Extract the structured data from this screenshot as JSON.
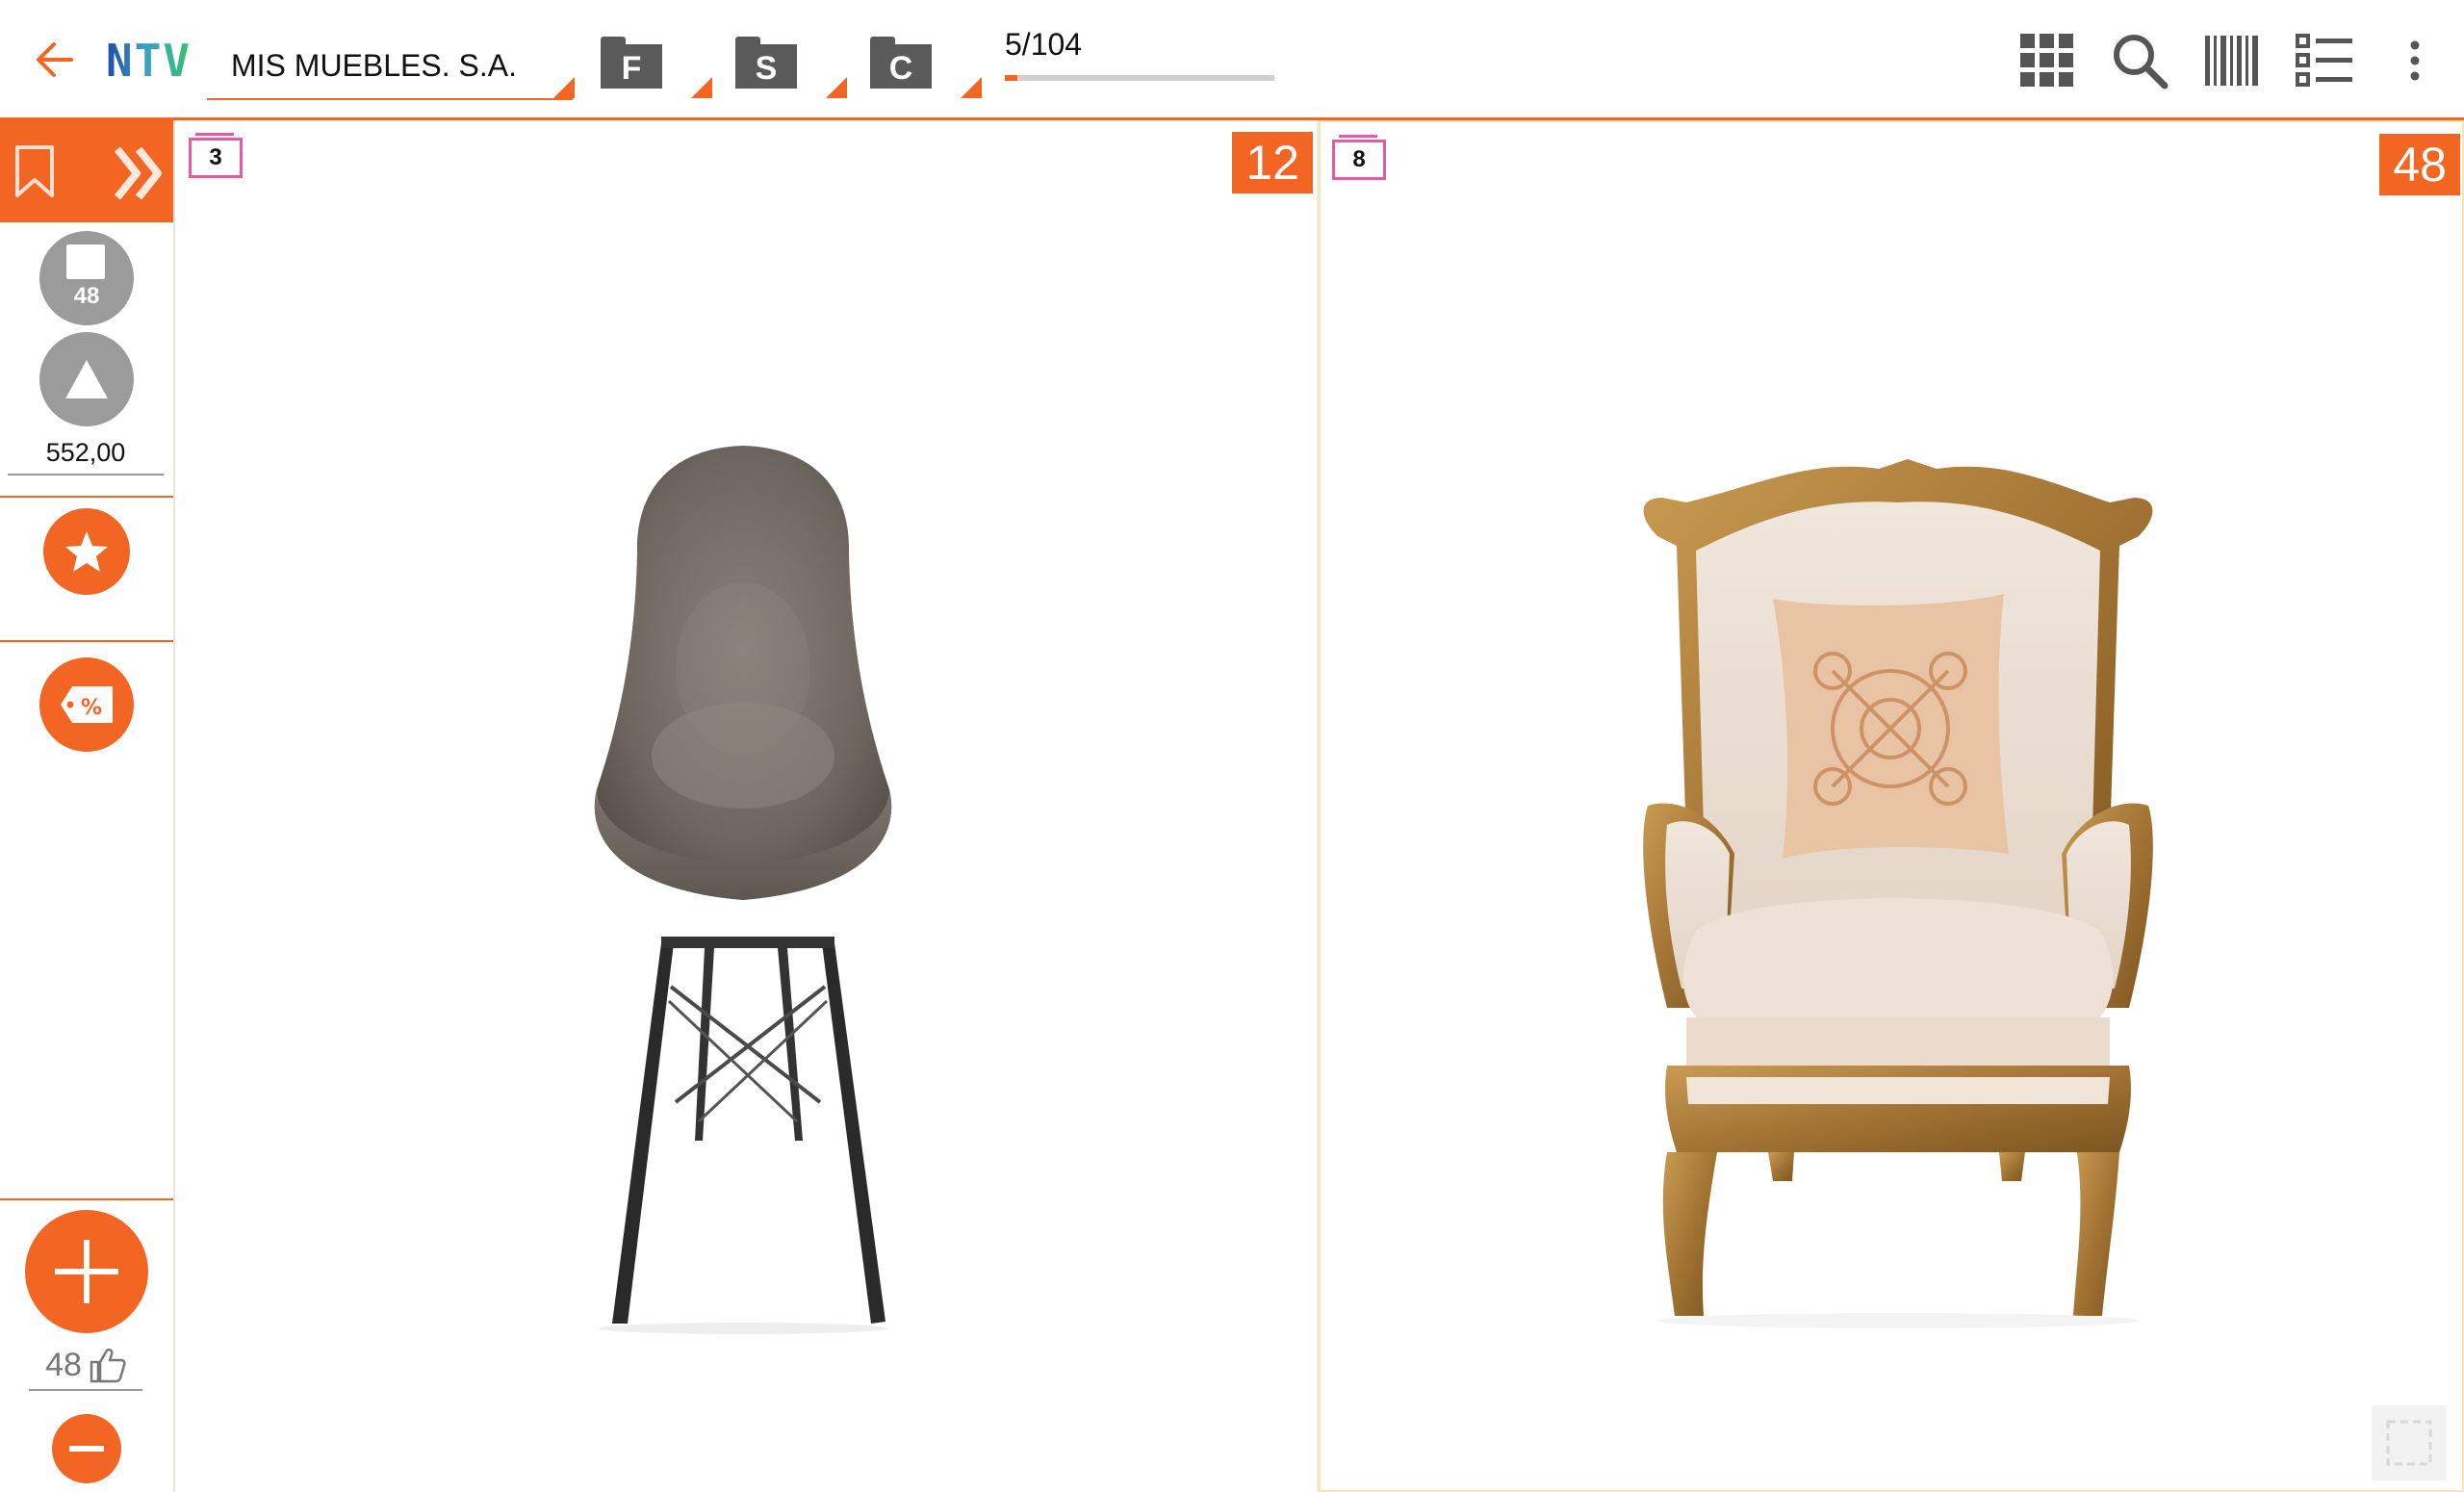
{
  "header": {
    "logo_text": "NTV",
    "company": "MIS MUEBLES. S.A.",
    "folders": [
      {
        "label": "F"
      },
      {
        "label": "S"
      },
      {
        "label": "C"
      }
    ],
    "counter": "5/104",
    "progress_fraction": 0.048,
    "icons": [
      "grid-icon",
      "search-icon",
      "barcode-icon",
      "list-icon",
      "more-vert-icon"
    ]
  },
  "left_panel": {
    "cart_count": "48",
    "price": "552,00",
    "likes": "48",
    "colors": {
      "accent": "#f26522",
      "gray": "#9b9b9b"
    }
  },
  "products": [
    {
      "mini_badge": "3",
      "stock": "12",
      "name": "gray-plastic-eiffel-chair"
    },
    {
      "mini_badge": "8",
      "stock": "48",
      "name": "baroque-gilded-armchair"
    }
  ]
}
